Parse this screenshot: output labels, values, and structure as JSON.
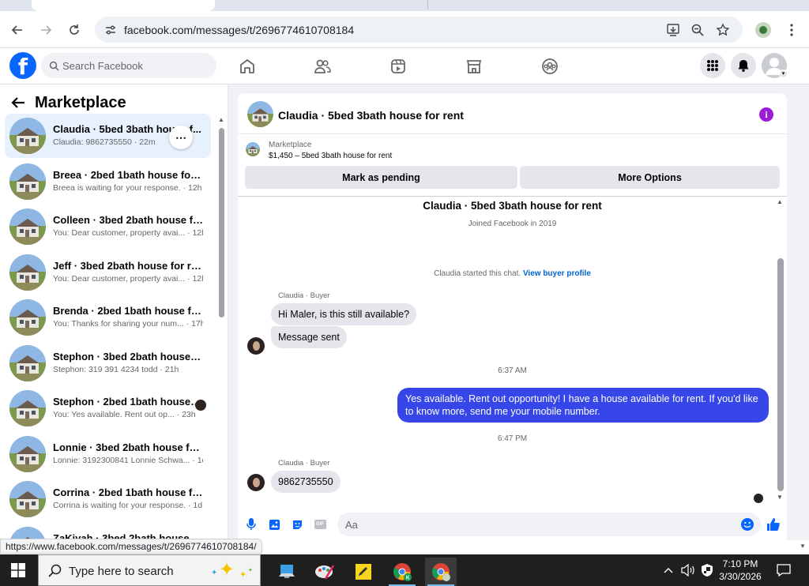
{
  "browser": {
    "url": "facebook.com/messages/t/2696774610708184",
    "status_url": "https://www.facebook.com/messages/t/2696774610708184/"
  },
  "fb": {
    "search_placeholder": "Search Facebook",
    "logo": "f"
  },
  "sidebar": {
    "title": "Marketplace",
    "conversations": [
      {
        "name": "Claudia · 5bed 3bath house f...",
        "snippet": "Claudia: 9862735550 · 22m",
        "active": true
      },
      {
        "name": "Breea · 2bed 1bath house for rent",
        "snippet": "Breea is waiting for your response. · 12h"
      },
      {
        "name": "Colleen · 3bed 2bath house for ...",
        "snippet": "You: Dear customer, property avai... · 12h"
      },
      {
        "name": "Jeff · 3bed 2bath house for rent",
        "snippet": "You: Dear customer, property avai... · 12h"
      },
      {
        "name": "Brenda · 2bed 1bath house for r...",
        "snippet": "You: Thanks for sharing your num... · 17h"
      },
      {
        "name": "Stephon · 3bed 2bath house for...",
        "snippet": "Stephon: 319 391 4234 todd · 21h"
      },
      {
        "name": "Stephon · 2bed 1bath house f...",
        "snippet": "You: Yes available. Rent out op... · 23h"
      },
      {
        "name": "Lonnie · 3bed 2bath house for r...",
        "snippet": "Lonnie: 3192300841 Lonnie Schwa... · 1d"
      },
      {
        "name": "Corrina · 2bed 1bath house for r...",
        "snippet": "Corrina is waiting for your response. · 1d"
      },
      {
        "name": "ZaKiyah · 3bed 2bath house for...",
        "snippet": ""
      }
    ]
  },
  "chat": {
    "title": "Claudia · 5bed 3bath house for rent",
    "listing_category": "Marketplace",
    "listing_title": "$1,450 – 5bed 3bath house for rent",
    "mark_pending": "Mark as pending",
    "more_options": "More Options",
    "profile_name": "Claudia · 5bed 3bath house for rent",
    "joined": "Joined Facebook in 2019",
    "started_text": "Claudia started this chat.",
    "view_profile": "View buyer profile",
    "sender_label": "Claudia · Buyer",
    "msg1": "Hi Maler, is this still available?",
    "msg2": "Message sent",
    "time1": "6:37 AM",
    "my_msg": "Yes available. Rent out opportunity! I have a house available for rent. If you'd like to know more, send me your mobile number.",
    "time2": "6:47 PM",
    "sender_label2": "Claudia · Buyer",
    "msg3": "9862735550",
    "composer_placeholder": "Aa"
  },
  "taskbar": {
    "search_placeholder": "Type here to search",
    "time": "7:10 PM",
    "date": "3/30/2026"
  },
  "colors": {
    "fb_blue": "#0866ff",
    "my_bubble": "#3646e8",
    "info_purple": "#9b1bd6"
  }
}
